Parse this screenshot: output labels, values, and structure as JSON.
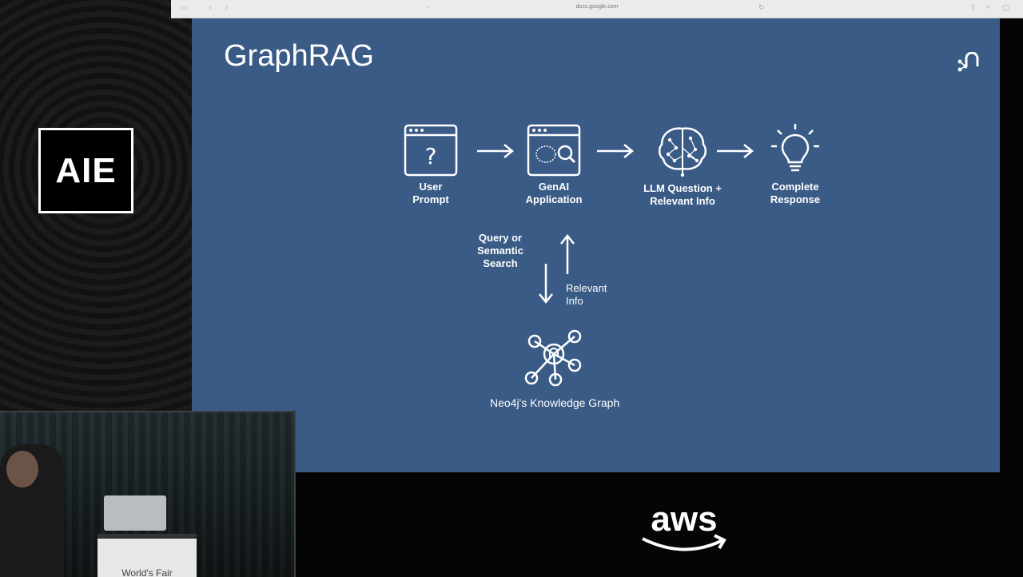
{
  "browser": {
    "url": "docs.google.com"
  },
  "event_logo": {
    "text": "AIE"
  },
  "slide": {
    "title": "GraphRAG",
    "steps": [
      {
        "label": "User\nPrompt",
        "icon": "browser-question-icon"
      },
      {
        "label": "GenAI\nApplication",
        "icon": "browser-search-brain-icon"
      },
      {
        "label": "LLM Question +\nRelevant Info",
        "icon": "brain-network-icon"
      },
      {
        "label": "Complete\nResponse",
        "icon": "lightbulb-icon"
      }
    ],
    "query_label": "Query or\nSemantic\nSearch",
    "relevant_label": "Relevant\nInfo",
    "graph_label": "Neo4j's Knowledge Graph"
  },
  "camera": {
    "podium_text": "World's Fair"
  },
  "sponsor": {
    "name": "aws"
  },
  "colors": {
    "slide_bg": "#3a5b86",
    "aws_orange": "#ffffff"
  }
}
